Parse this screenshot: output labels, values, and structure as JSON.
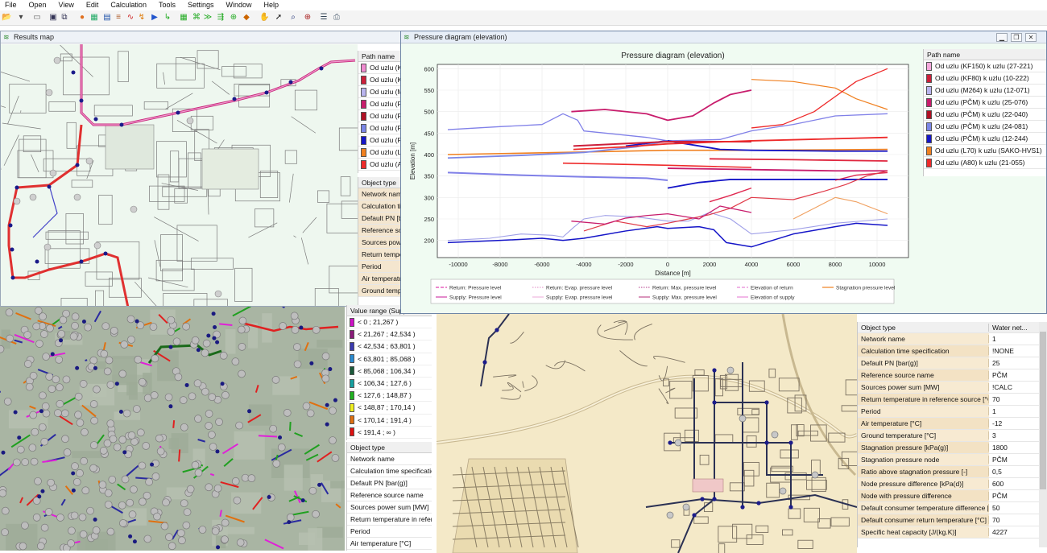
{
  "menu": [
    "File",
    "Open",
    "View",
    "Edit",
    "Calculation",
    "Tools",
    "Settings",
    "Window",
    "Help"
  ],
  "results_window": {
    "title": "Results map",
    "path_panel": {
      "header": "Path name",
      "items": [
        {
          "label": "Od uzlu (KF",
          "color": "#f08ad0"
        },
        {
          "label": "Od uzlu (KF",
          "color": "#cc1f3a"
        },
        {
          "label": "Od uzlu (M2",
          "color": "#b9b4ee"
        },
        {
          "label": "Od uzlu (PČ",
          "color": "#c81c6c"
        },
        {
          "label": "Od uzlu (PČ",
          "color": "#b01024"
        },
        {
          "label": "Od uzlu (PČ",
          "color": "#7b86e6"
        },
        {
          "label": "Od uzlu (PČ",
          "color": "#1515c8"
        },
        {
          "label": "Od uzlu (L7",
          "color": "#f08020"
        },
        {
          "label": "Od uzlu (A8",
          "color": "#ee2a2a"
        }
      ]
    },
    "object_panel": {
      "header": "Object type",
      "rows": [
        "Network name",
        "Calculation tim",
        "Default PN [ba",
        "Reference sour",
        "Sources power",
        "Return temper",
        "Period",
        "Air temperatur",
        "Ground temper"
      ]
    }
  },
  "pressure_window": {
    "title": "Pressure diagram (elevation)",
    "path_panel": {
      "header": "Path name",
      "items": [
        {
          "label": "Od uzlu (KF150) k uzlu (27-221)",
          "color": "#f5a8dc"
        },
        {
          "label": "Od uzlu (KF80) k uzlu (10-222)",
          "color": "#cc1f3a"
        },
        {
          "label": "Od uzlu (M264) k uzlu (12-071)",
          "color": "#b9b4ee"
        },
        {
          "label": "Od uzlu (PČM) k uzlu (25-076)",
          "color": "#c81c6c"
        },
        {
          "label": "Od uzlu (PČM) k uzlu (22-040)",
          "color": "#b01024"
        },
        {
          "label": "Od uzlu (PČM) k uzlu (24-081)",
          "color": "#7b86e6"
        },
        {
          "label": "Od uzlu (PČM) k uzlu (12-244)",
          "color": "#1515c8"
        },
        {
          "label": "Od uzlu (L70) k uzlu (SAKO-HVS1)",
          "color": "#f08020"
        },
        {
          "label": "Od uzlu (A80) k uzlu (21-055)",
          "color": "#ee2a2a"
        }
      ]
    }
  },
  "chart_data": {
    "type": "line",
    "title": "Pressure diagram (elevation)",
    "xlabel": "Distance [m]",
    "ylabel": "Elevation [m]",
    "xlim": [
      -11000,
      11500
    ],
    "ylim": [
      160,
      610
    ],
    "xticks": [
      -10000,
      -8000,
      -6000,
      -4000,
      -2000,
      0,
      2000,
      4000,
      6000,
      8000,
      10000
    ],
    "yticks": [
      200,
      250,
      300,
      350,
      400,
      450,
      500,
      550,
      600
    ],
    "grid": true,
    "legend_placement": "bottom",
    "legend": [
      {
        "label": "Return: Pressure level",
        "style": "dash",
        "color": "#e040b0"
      },
      {
        "label": "Return: Evap. pressure level",
        "style": "dot",
        "color": "#e8a0d0"
      },
      {
        "label": "Return: Max. pressure level",
        "style": "dot",
        "color": "#c060a0"
      },
      {
        "label": "Elevation of return",
        "style": "dash",
        "color": "#e888d8"
      },
      {
        "label": "Stagnation pressure level",
        "style": "solid",
        "color": "#f08020"
      },
      {
        "label": "Supply: Pressure level",
        "style": "solid",
        "color": "#d040a8"
      },
      {
        "label": "Supply: Evap. pressure level",
        "style": "solid",
        "color": "#f0b8e0"
      },
      {
        "label": "Supply: Max. pressure level",
        "style": "solid",
        "color": "#c05090"
      },
      {
        "label": "Elevation of supply",
        "style": "solid",
        "color": "#e888d8"
      }
    ],
    "series": [
      {
        "color": "#f08020",
        "width": 1.6,
        "points": [
          [
            -10500,
            400
          ],
          [
            -5000,
            405
          ],
          [
            0,
            410
          ],
          [
            4000,
            410
          ],
          [
            10500,
            412
          ]
        ]
      },
      {
        "color": "#f08020",
        "width": 1.2,
        "points": [
          [
            4000,
            575
          ],
          [
            6000,
            570
          ],
          [
            8000,
            555
          ],
          [
            9000,
            530
          ],
          [
            10500,
            505
          ]
        ]
      },
      {
        "color": "#8080e8",
        "width": 1.3,
        "points": [
          [
            -10500,
            458
          ],
          [
            -8000,
            465
          ],
          [
            -6000,
            470
          ],
          [
            -5000,
            495
          ],
          [
            -4300,
            480
          ],
          [
            -4000,
            455
          ],
          [
            -3000,
            450
          ],
          [
            -1000,
            440
          ],
          [
            0,
            432
          ],
          [
            2500,
            435
          ],
          [
            4000,
            455
          ],
          [
            6000,
            470
          ],
          [
            8000,
            490
          ],
          [
            10500,
            495
          ]
        ]
      },
      {
        "color": "#1515c8",
        "width": 1.8,
        "points": [
          [
            -2000,
            420
          ],
          [
            0,
            432
          ],
          [
            2500,
            412
          ],
          [
            4000,
            410
          ],
          [
            8000,
            408
          ],
          [
            10500,
            408
          ]
        ]
      },
      {
        "color": "#7b86e6",
        "width": 1.8,
        "points": [
          [
            -10500,
            392
          ],
          [
            -7000,
            398
          ],
          [
            -4000,
            405
          ],
          [
            -1500,
            418
          ],
          [
            0,
            432
          ]
        ]
      },
      {
        "color": "#cc1f3a",
        "width": 2,
        "points": [
          [
            -4500,
            420
          ],
          [
            0,
            430
          ],
          [
            4000,
            430
          ]
        ]
      },
      {
        "color": "#ee2a2a",
        "width": 1.8,
        "points": [
          [
            -4500,
            412
          ],
          [
            -2000,
            418
          ],
          [
            0,
            425
          ],
          [
            4000,
            432
          ],
          [
            10500,
            440
          ]
        ]
      },
      {
        "color": "#c81c6c",
        "width": 1.8,
        "points": [
          [
            -4600,
            500
          ],
          [
            -3000,
            505
          ],
          [
            -1000,
            495
          ],
          [
            0,
            480
          ],
          [
            1200,
            490
          ],
          [
            2200,
            520
          ],
          [
            3000,
            540
          ],
          [
            4000,
            550
          ]
        ]
      },
      {
        "color": "#ee2a2a",
        "width": 1.3,
        "points": [
          [
            4000,
            462
          ],
          [
            5500,
            470
          ],
          [
            7000,
            500
          ],
          [
            8000,
            535
          ],
          [
            9000,
            570
          ],
          [
            10000,
            590
          ],
          [
            10500,
            600
          ]
        ]
      },
      {
        "color": "#e02840",
        "width": 1.8,
        "points": [
          [
            2000,
            390
          ],
          [
            6000,
            388
          ],
          [
            10500,
            385
          ]
        ]
      },
      {
        "color": "#ee2a2a",
        "width": 1.6,
        "points": [
          [
            -5000,
            380
          ],
          [
            0,
            375
          ],
          [
            4000,
            370
          ]
        ]
      },
      {
        "color": "#c81c6c",
        "width": 1.8,
        "points": [
          [
            0,
            368
          ],
          [
            4000,
            365
          ],
          [
            8000,
            362
          ],
          [
            10500,
            362
          ]
        ]
      },
      {
        "color": "#8080e8",
        "width": 2,
        "points": [
          [
            -10500,
            358
          ],
          [
            -7000,
            352
          ],
          [
            -4000,
            348
          ],
          [
            -1000,
            345
          ],
          [
            0,
            340
          ]
        ]
      },
      {
        "color": "#1515c8",
        "width": 1.8,
        "points": [
          [
            0,
            322
          ],
          [
            1500,
            335
          ],
          [
            3000,
            342
          ],
          [
            6000,
            342
          ],
          [
            9000,
            342
          ],
          [
            10500,
            342
          ]
        ]
      },
      {
        "color": "#e02850",
        "width": 1.4,
        "points": [
          [
            8000,
            340
          ],
          [
            9000,
            352
          ],
          [
            10500,
            358
          ]
        ]
      },
      {
        "color": "#e02850",
        "width": 1.4,
        "points": [
          [
            2000,
            290
          ],
          [
            3000,
            305
          ],
          [
            4000,
            322
          ]
        ]
      },
      {
        "color": "#a0a0e8",
        "width": 1.1,
        "points": [
          [
            -10500,
            200
          ],
          [
            -8500,
            205
          ],
          [
            -7000,
            215
          ],
          [
            -5500,
            212
          ],
          [
            -5000,
            208
          ],
          [
            -4500,
            230
          ],
          [
            -4000,
            250
          ],
          [
            -3000,
            258
          ],
          [
            -1500,
            255
          ],
          [
            0,
            245
          ],
          [
            1000,
            245
          ],
          [
            2000,
            265
          ],
          [
            3000,
            250
          ],
          [
            4000,
            215
          ],
          [
            6000,
            225
          ],
          [
            8000,
            240
          ],
          [
            10500,
            250
          ]
        ]
      },
      {
        "color": "#1515c8",
        "width": 1.5,
        "points": [
          [
            -10500,
            195
          ],
          [
            -8000,
            200
          ],
          [
            -6000,
            205
          ],
          [
            -5000,
            200
          ],
          [
            -4000,
            205
          ],
          [
            -2000,
            222
          ],
          [
            -500,
            232
          ],
          [
            0,
            228
          ],
          [
            1500,
            232
          ],
          [
            2200,
            225
          ],
          [
            2800,
            195
          ],
          [
            4000,
            185
          ],
          [
            6000,
            215
          ],
          [
            8000,
            232
          ],
          [
            9000,
            240
          ],
          [
            10500,
            235
          ]
        ]
      },
      {
        "color": "#e03a48",
        "width": 1.2,
        "points": [
          [
            -4000,
            222
          ],
          [
            -2500,
            245
          ],
          [
            -1000,
            232
          ],
          [
            0,
            240
          ],
          [
            1000,
            250
          ],
          [
            2000,
            260
          ],
          [
            3000,
            275
          ],
          [
            4000,
            300
          ],
          [
            6000,
            295
          ],
          [
            7500,
            315
          ],
          [
            8500,
            330
          ],
          [
            9500,
            350
          ],
          [
            10500,
            362
          ]
        ]
      },
      {
        "color": "#f0a060",
        "width": 1.1,
        "points": [
          [
            6000,
            250
          ],
          [
            8000,
            300
          ],
          [
            9000,
            290
          ],
          [
            10500,
            262
          ]
        ]
      },
      {
        "color": "#c81c6c",
        "width": 1.3,
        "points": [
          [
            -4600,
            245
          ],
          [
            -3000,
            238
          ],
          [
            -2000,
            252
          ],
          [
            -1000,
            258
          ],
          [
            0,
            262
          ],
          [
            1500,
            250
          ],
          [
            2500,
            280
          ],
          [
            4000,
            265
          ]
        ]
      }
    ]
  },
  "value_range_panel": {
    "header": "Value range (Supp",
    "items": [
      {
        "label": "< 0 ; 21,267 )",
        "color": "#d010c8"
      },
      {
        "label": "< 21,267 ; 42,534 )",
        "color": "#8a1a7a"
      },
      {
        "label": "< 42,534 ; 63,801 )",
        "color": "#3a3ab0"
      },
      {
        "label": "< 63,801 ; 85,068 )",
        "color": "#2a8ad0"
      },
      {
        "label": "< 85,068 ; 106,34 )",
        "color": "#1a5a3a"
      },
      {
        "label": "< 106,34 ; 127,6 )",
        "color": "#16a0a0"
      },
      {
        "label": "< 127,6 ; 148,87 )",
        "color": "#20b020"
      },
      {
        "label": "< 148,87 ; 170,14 )",
        "color": "#f0f020"
      },
      {
        "label": "< 170,14 ; 191,4 )",
        "color": "#e07010"
      },
      {
        "label": "< 191,4 ; ∞ )",
        "color": "#e01010"
      }
    ]
  },
  "bottom_left_object_panel": {
    "header": "Object type",
    "rows": [
      "Network name",
      "Calculation time specification",
      "Default PN [bar(g)]",
      "Reference source name",
      "Sources power sum [MW]",
      "Return temperature in referen",
      "Period",
      "Air temperature [°C]"
    ]
  },
  "properties_panel": {
    "header_key": "Object type",
    "header_value": "Water net...",
    "rows": [
      {
        "key": "Network name",
        "value": "1"
      },
      {
        "key": "Calculation time specification",
        "value": "!NONE"
      },
      {
        "key": "Default PN [bar(g)]",
        "value": "25"
      },
      {
        "key": "Reference source name",
        "value": "PČM"
      },
      {
        "key": "Sources power sum [MW]",
        "value": "!CALC"
      },
      {
        "key": "Return temperature in reference source [°C]",
        "value": "70"
      },
      {
        "key": "Period",
        "value": "1"
      },
      {
        "key": "Air temperature [°C]",
        "value": "-12"
      },
      {
        "key": "Ground temperature [°C]",
        "value": "3"
      },
      {
        "key": "Stagnation pressure [kPa(g)]",
        "value": "1800"
      },
      {
        "key": "Stagnation pressure node",
        "value": "PČM"
      },
      {
        "key": "Ratio above stagnation pressure [-]",
        "value": "0,5"
      },
      {
        "key": "Node pressure difference [kPa(d)]",
        "value": "600"
      },
      {
        "key": "Node with pressure difference",
        "value": "PČM"
      },
      {
        "key": "Default consumer temperature difference [°C]",
        "value": "50"
      },
      {
        "key": "Default consumer return temperature [°C]",
        "value": "70"
      },
      {
        "key": "Specific heat capacity [J/(kg.K)]",
        "value": "4227"
      }
    ]
  }
}
